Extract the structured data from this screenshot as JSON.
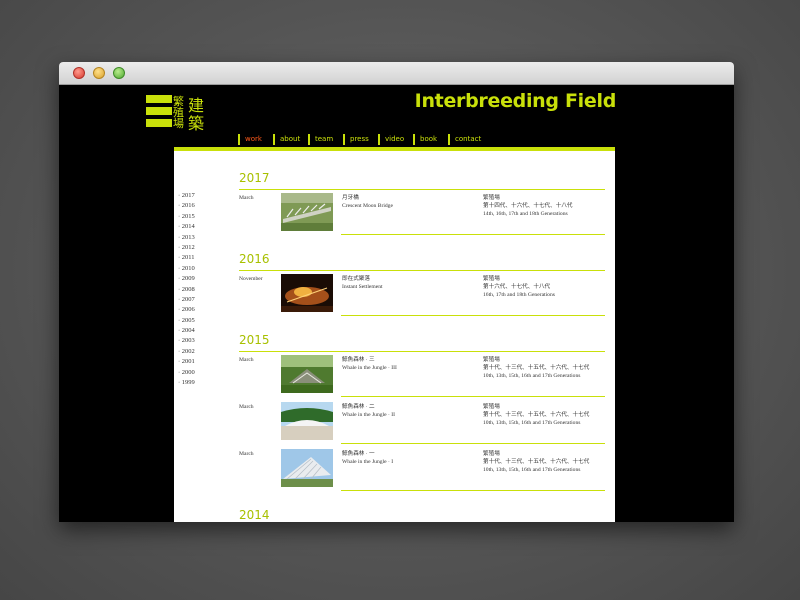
{
  "site": {
    "title": "Interbreeding Field",
    "logo_text": [
      "繁",
      "殖",
      "場",
      "建",
      "築"
    ]
  },
  "nav": [
    "work",
    "about",
    "team",
    "press",
    "video",
    "book",
    "contact"
  ],
  "nav_active": "work",
  "years": [
    "2017",
    "2016",
    "2015",
    "2014",
    "2013",
    "2012",
    "2011",
    "2010",
    "2009",
    "2008",
    "2007",
    "2006",
    "2005",
    "2004",
    "2003",
    "2002",
    "2001",
    "2000",
    "1999"
  ],
  "year_prefix": "· ",
  "sections": [
    {
      "year": "2017",
      "entries": [
        {
          "month": "March",
          "title_zh": "月牙橋",
          "title_en": "Crescent Moon Bridge",
          "credit_zh": "繁殖場",
          "gen_zh": "第十四代、十六代、十七代、十八代",
          "gen_en": "14th, 16th, 17th and 18th Generations",
          "thumb": "bridge"
        }
      ]
    },
    {
      "year": "2016",
      "entries": [
        {
          "month": "November",
          "title_zh": "即在式聚落",
          "title_en": "Instant Settlement",
          "credit_zh": "繁殖場",
          "gen_zh": "第十六代、十七代、十八代",
          "gen_en": "16th, 17th and 18th Generations",
          "thumb": "night"
        }
      ]
    },
    {
      "year": "2015",
      "entries": [
        {
          "month": "March",
          "title_zh": "鯨魚森林 · 三",
          "title_en": "Whale in the Jungle · III",
          "credit_zh": "繁殖場",
          "gen_zh": "第十代、十三代、十五代、十六代、十七代",
          "gen_en": "10th, 13th, 15th, 16th and 17th Generations",
          "thumb": "jungle3"
        },
        {
          "month": "March",
          "title_zh": "鯨魚森林 · 二",
          "title_en": "Whale in the Jungle · II",
          "credit_zh": "繁殖場",
          "gen_zh": "第十代、十三代、十五代、十六代、十七代",
          "gen_en": "10th, 13th, 15th, 16th and 17th Generations",
          "thumb": "jungle2"
        },
        {
          "month": "March",
          "title_zh": "鯨魚森林 · 一",
          "title_en": "Whale in the Jungle · I",
          "credit_zh": "繁殖場",
          "gen_zh": "第十代、十三代、十五代、十六代、十七代",
          "gen_en": "10th, 13th, 15th, 16th and 17th Generations",
          "thumb": "jungle1"
        }
      ]
    },
    {
      "year": "2014",
      "entries": []
    }
  ],
  "colors": {
    "accent": "#c9e00a",
    "active": "#ff5a1a",
    "background": "#000000",
    "panel": "#ffffff"
  }
}
